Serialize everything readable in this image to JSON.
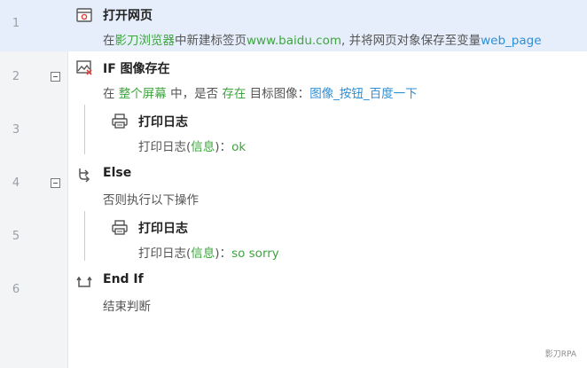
{
  "line_numbers": [
    "1",
    "2",
    "3",
    "4",
    "5",
    "6"
  ],
  "steps": {
    "open_page": {
      "title": "打开网页",
      "desc_1": "在",
      "browser": "影刀浏览器",
      "desc_2": "中新建标签页",
      "url": "www.baidu.com",
      "desc_3": ", 并将网页对象保存至变量",
      "var": "web_page"
    },
    "if_image": {
      "title": "IF 图像存在",
      "desc_1": "在 ",
      "scope": "整个屏幕",
      "desc_2": " 中，是否 ",
      "condition": "存在",
      "desc_3": " 目标图像：",
      "target": "图像_按钮_百度一下"
    },
    "log_1": {
      "title": "打印日志",
      "desc_1": "打印日志(",
      "param": "信息",
      "desc_2": ")：",
      "value": "ok"
    },
    "else": {
      "title": "Else",
      "desc": "否则执行以下操作"
    },
    "log_2": {
      "title": "打印日志",
      "desc_1": "打印日志(",
      "param": "信息",
      "desc_2": ")：",
      "value": "so sorry"
    },
    "end_if": {
      "title": "End If",
      "desc": "结束判断"
    }
  },
  "watermark": "影刀RPA",
  "colors": {
    "selected_row": "#e6eefb",
    "green": "#3ea53e",
    "blue": "#2d8fd5"
  }
}
